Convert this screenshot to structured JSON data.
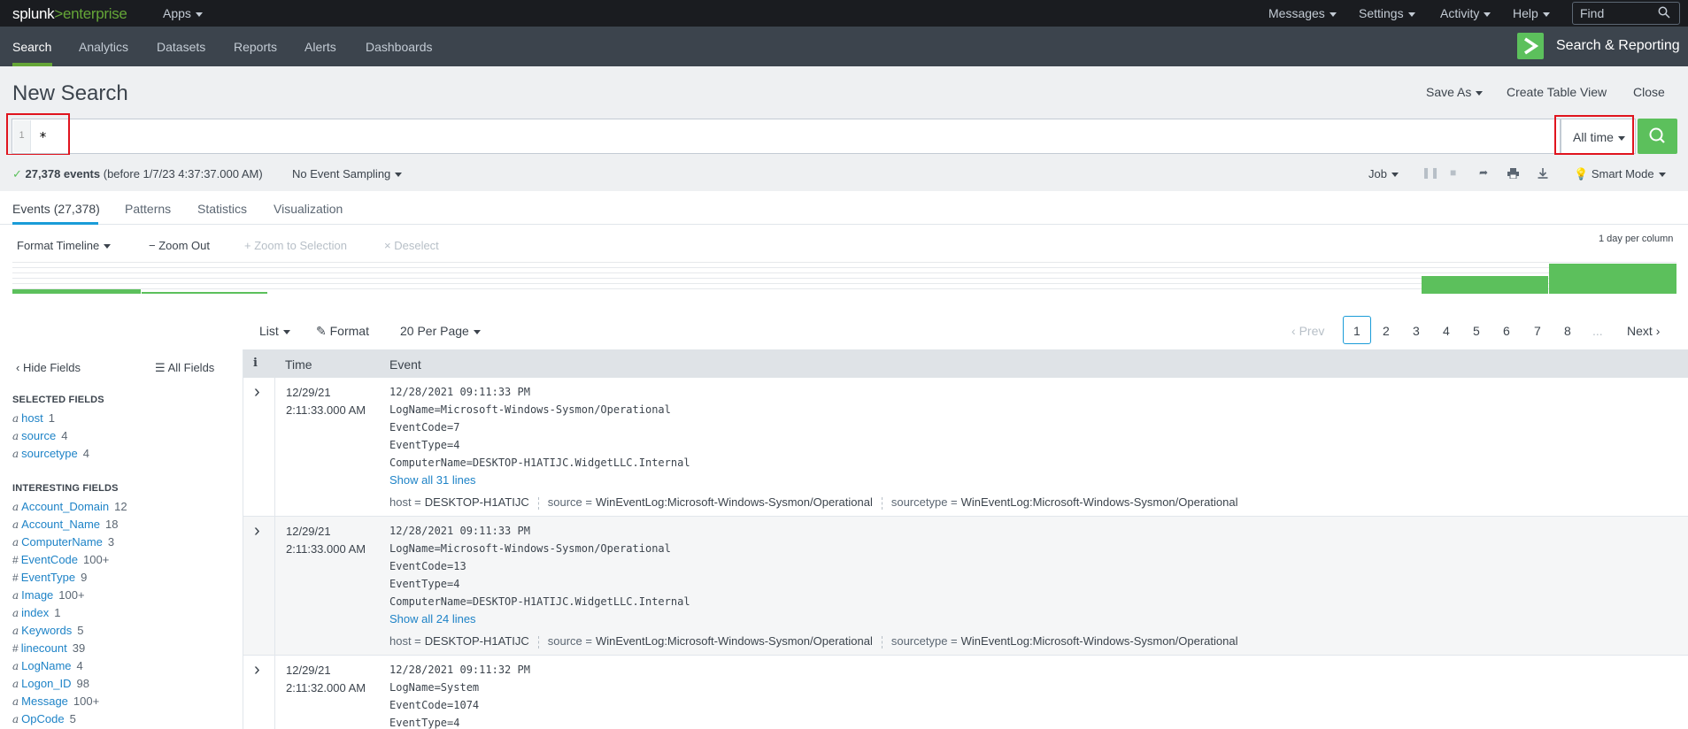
{
  "topbar": {
    "logo_brand": "splunk",
    "logo_sep": ">",
    "logo_product": "enterprise",
    "apps": "Apps",
    "menus": [
      "Messages",
      "Settings",
      "Activity",
      "Help"
    ],
    "find_placeholder": "Find"
  },
  "appbar": {
    "tabs": [
      "Search",
      "Analytics",
      "Datasets",
      "Reports",
      "Alerts",
      "Dashboards"
    ],
    "active_tab": "Search",
    "app_title": "Search & Reporting",
    "brand_color": "#5cc05c"
  },
  "header": {
    "title": "New Search",
    "save_as": "Save As",
    "create_table": "Create Table View",
    "close": "Close"
  },
  "search": {
    "line_number": "1",
    "query": "*",
    "time_range": "All time"
  },
  "status": {
    "check": "✓",
    "count": "27,378 events",
    "before": "(before 1/7/23 4:37:37.000 AM)",
    "sampling": "No Event Sampling",
    "job": "Job",
    "mode": "Smart Mode"
  },
  "result_tabs": [
    "Events (27,378)",
    "Patterns",
    "Statistics",
    "Visualization"
  ],
  "timeline": {
    "format": "Format Timeline",
    "zoom_out": "Zoom Out",
    "zoom_selection": "Zoom to Selection",
    "deselect": "Deselect",
    "per_column": "1 day per column",
    "bar_color": "#5cc05c"
  },
  "list_controls": {
    "list": "List",
    "format": "Format",
    "per_page": "20 Per Page"
  },
  "pagination": {
    "prev": "Prev",
    "pages": [
      "1",
      "2",
      "3",
      "4",
      "5",
      "6",
      "7",
      "8"
    ],
    "ellipsis": "...",
    "next": "Next",
    "current": "1"
  },
  "sidebar": {
    "hide_fields": "Hide Fields",
    "all_fields": "All Fields",
    "selected_heading": "SELECTED FIELDS",
    "selected": [
      {
        "type": "a",
        "name": "host",
        "count": "1"
      },
      {
        "type": "a",
        "name": "source",
        "count": "4"
      },
      {
        "type": "a",
        "name": "sourcetype",
        "count": "4"
      }
    ],
    "interesting_heading": "INTERESTING FIELDS",
    "interesting": [
      {
        "type": "a",
        "name": "Account_Domain",
        "count": "12"
      },
      {
        "type": "a",
        "name": "Account_Name",
        "count": "18"
      },
      {
        "type": "a",
        "name": "ComputerName",
        "count": "3"
      },
      {
        "type": "#",
        "name": "EventCode",
        "count": "100+"
      },
      {
        "type": "#",
        "name": "EventType",
        "count": "9"
      },
      {
        "type": "a",
        "name": "Image",
        "count": "100+"
      },
      {
        "type": "a",
        "name": "index",
        "count": "1"
      },
      {
        "type": "a",
        "name": "Keywords",
        "count": "5"
      },
      {
        "type": "#",
        "name": "linecount",
        "count": "39"
      },
      {
        "type": "a",
        "name": "LogName",
        "count": "4"
      },
      {
        "type": "a",
        "name": "Logon_ID",
        "count": "98"
      },
      {
        "type": "a",
        "name": "Message",
        "count": "100+"
      },
      {
        "type": "a",
        "name": "OpCode",
        "count": "5"
      }
    ]
  },
  "table": {
    "col_i": "i",
    "col_time": "Time",
    "col_event": "Event",
    "events": [
      {
        "date": "12/29/21",
        "time": "2:11:33.000 AM",
        "lines": [
          "12/28/2021 09:11:33 PM",
          "LogName=Microsoft-Windows-Sysmon/Operational",
          "EventCode=7",
          "EventType=4",
          "ComputerName=DESKTOP-H1ATIJC.WidgetLLC.Internal"
        ],
        "show_all": "Show all 31 lines",
        "host": "DESKTOP-H1ATIJC",
        "source": "WinEventLog:Microsoft-Windows-Sysmon/Operational",
        "sourcetype": "WinEventLog:Microsoft-Windows-Sysmon/Operational"
      },
      {
        "date": "12/29/21",
        "time": "2:11:33.000 AM",
        "lines": [
          "12/28/2021 09:11:33 PM",
          "LogName=Microsoft-Windows-Sysmon/Operational",
          "EventCode=13",
          "EventType=4",
          "ComputerName=DESKTOP-H1ATIJC.WidgetLLC.Internal"
        ],
        "show_all": "Show all 24 lines",
        "host": "DESKTOP-H1ATIJC",
        "source": "WinEventLog:Microsoft-Windows-Sysmon/Operational",
        "sourcetype": "WinEventLog:Microsoft-Windows-Sysmon/Operational"
      },
      {
        "date": "12/29/21",
        "time": "2:11:32.000 AM",
        "lines": [
          "12/28/2021 09:11:32 PM",
          "LogName=System",
          "EventCode=1074",
          "EventType=4"
        ]
      }
    ],
    "meta_keys": {
      "host": "host =",
      "source": "source =",
      "sourcetype": "sourcetype ="
    }
  }
}
